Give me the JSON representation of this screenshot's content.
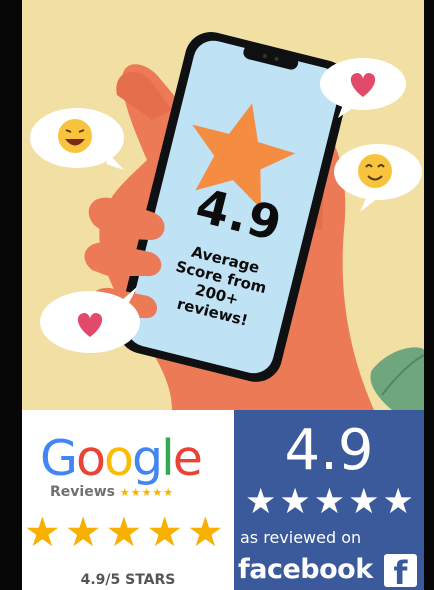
{
  "poster": {
    "score": "4.9",
    "caption_lines": [
      "Average",
      "Score from",
      "200+",
      "reviews!"
    ]
  },
  "google": {
    "logo_letters": [
      "G",
      "o",
      "o",
      "g",
      "l",
      "e"
    ],
    "logo_colors": [
      "#4285f4",
      "#ea4335",
      "#fbbc05",
      "#4285f4",
      "#34a853",
      "#ea4335"
    ],
    "reviews_label": "Reviews",
    "small_stars": "★★★★★",
    "big_stars": "★★★★★",
    "rating_caption": "4.9/5 STARS",
    "star_color": "#f7b000"
  },
  "facebook": {
    "score": "4.9",
    "stars": "★★★★★",
    "reviewed_on": "as reviewed on",
    "brand": "facebook",
    "logo_letter": "f",
    "brand_color": "#3a5a9b"
  }
}
